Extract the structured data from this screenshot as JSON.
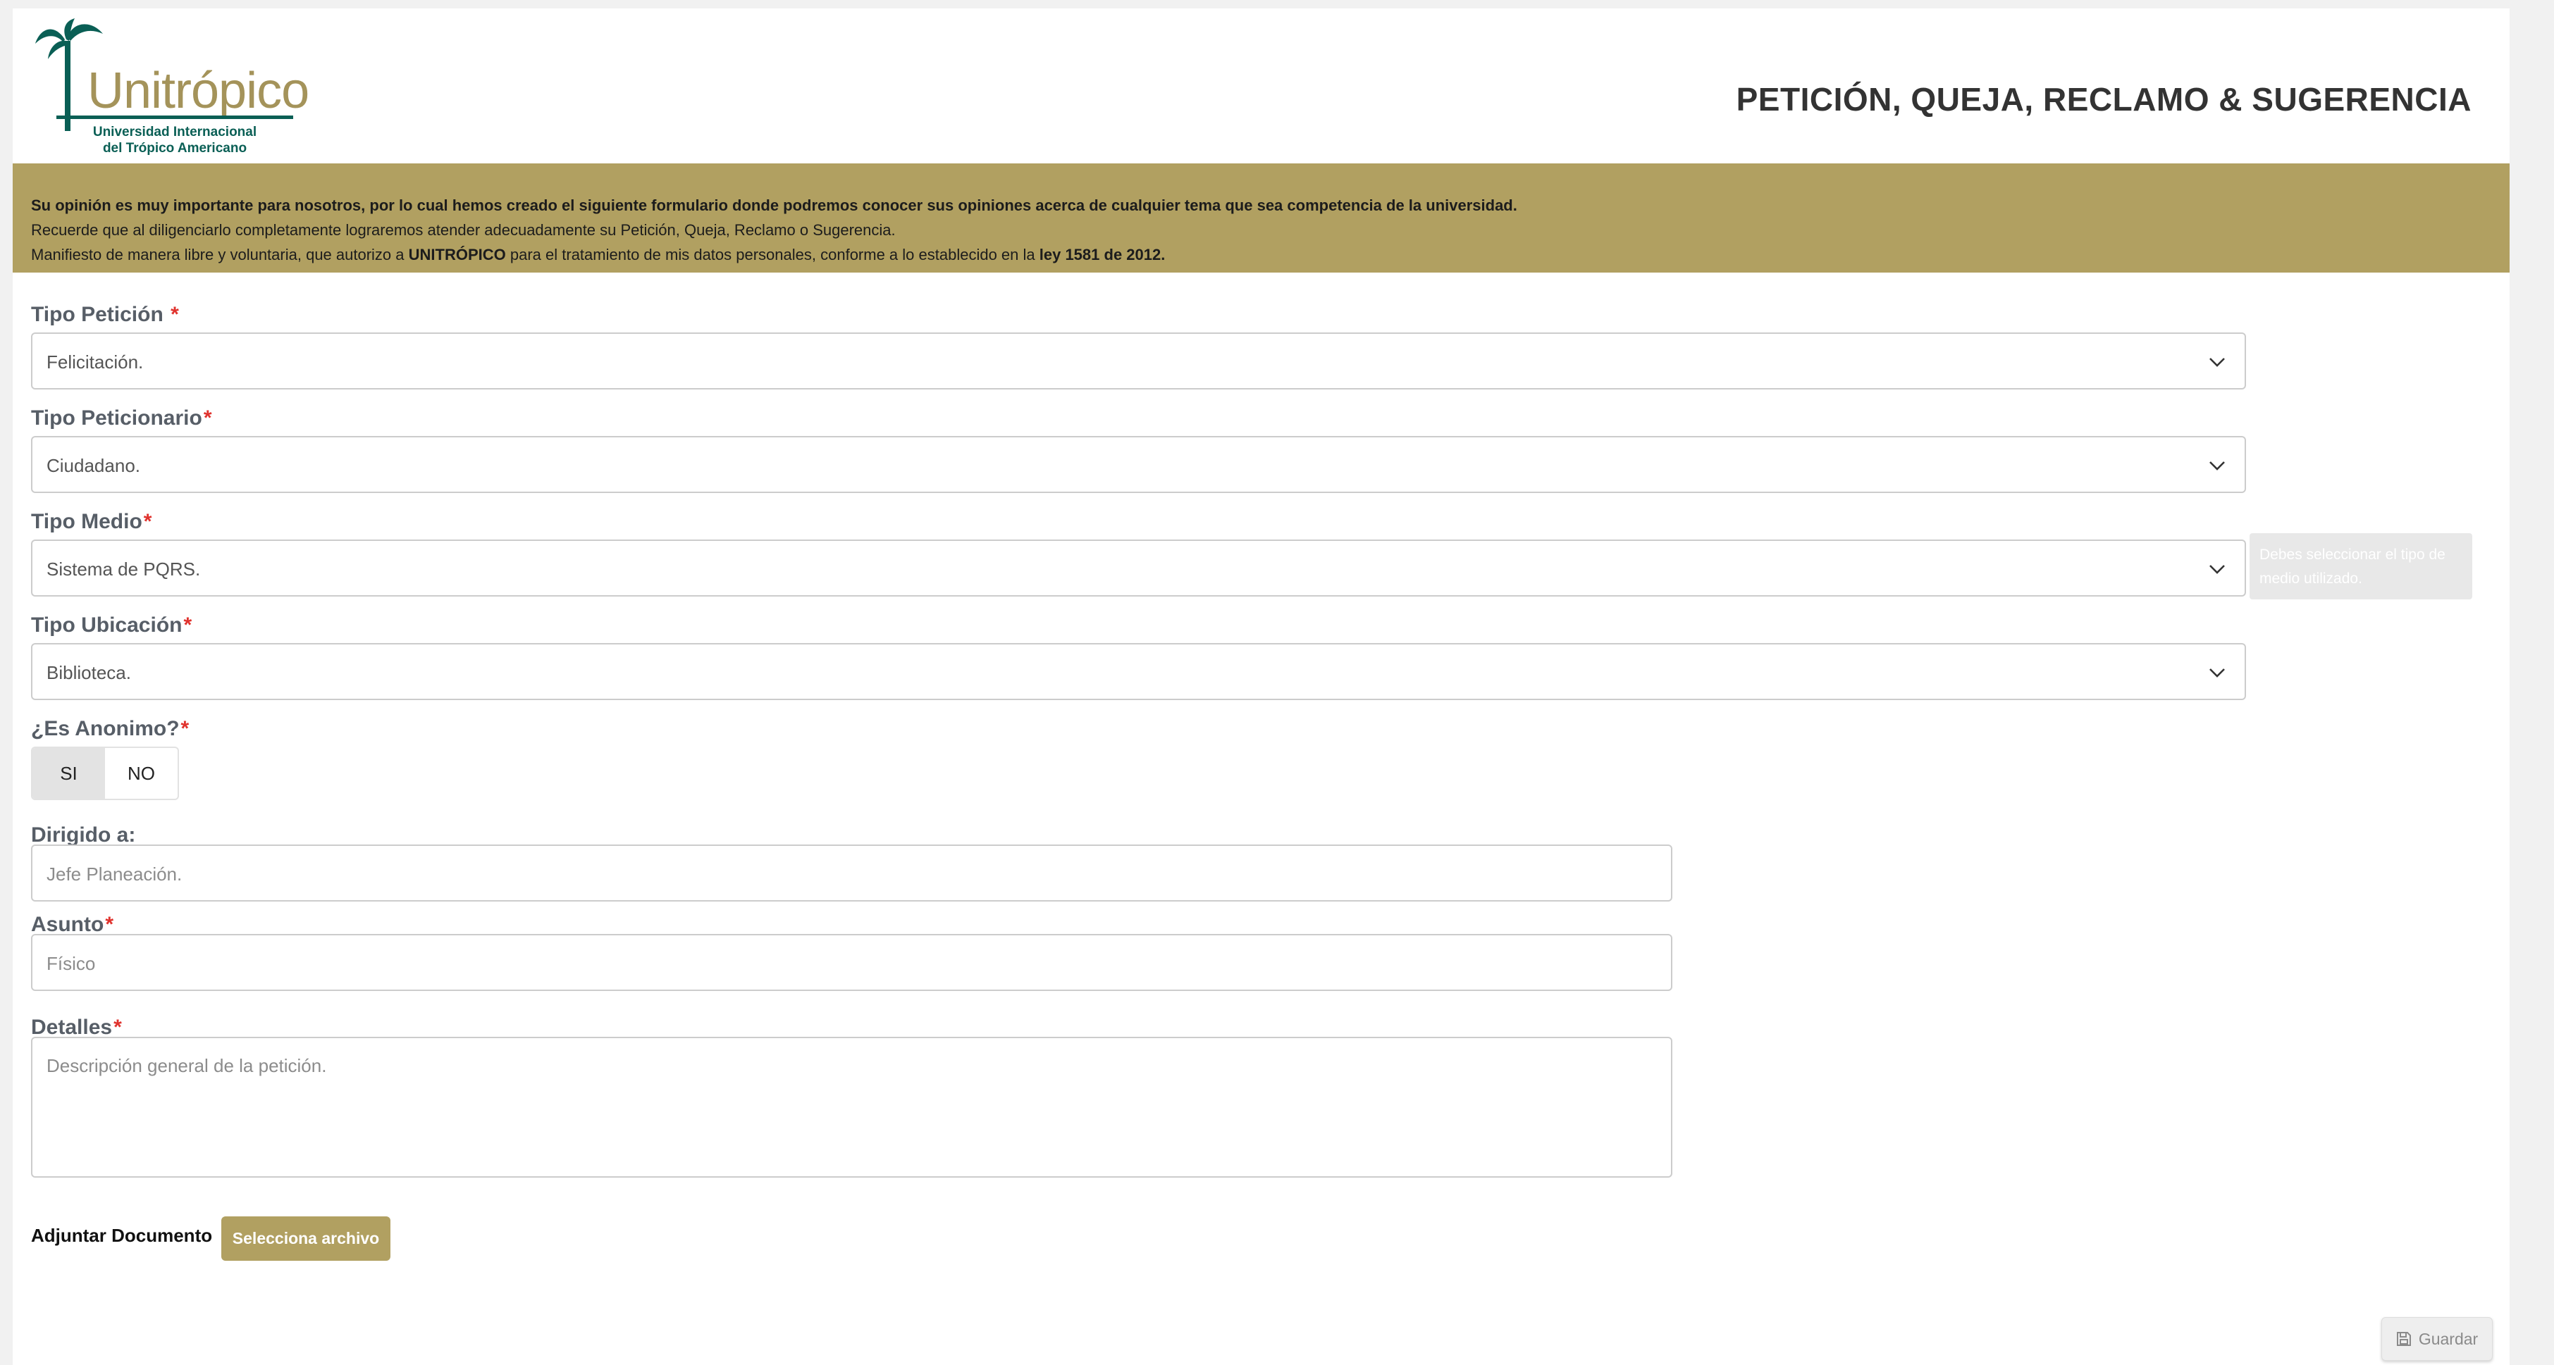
{
  "logo": {
    "word": "Unitrópico",
    "sub_line1": "Universidad Internacional",
    "sub_line2": "del Trópico Americano"
  },
  "header": {
    "title": "PETICIÓN, QUEJA, RECLAMO & SUGERENCIA"
  },
  "banner": {
    "line1": "Su opinión es muy importante para nosotros, por lo cual hemos creado el siguiente formulario donde podremos conocer sus opiniones acerca de cualquier tema que sea competencia de la universidad.",
    "line2": "Recuerde que al diligenciarlo completamente lograremos atender adecuadamente su Petición, Queja, Reclamo o Sugerencia.",
    "line3_a": "Manifiesto de manera libre y voluntaria, que autorizo a ",
    "line3_b": "UNITRÓPICO",
    "line3_c": " para el tratamiento de mis datos personales, conforme a lo establecido en la ",
    "line3_d": "ley 1581 de 2012."
  },
  "form": {
    "required_mark": "*",
    "tipo_peticion": {
      "label": "Tipo Petición",
      "value": "Felicitación."
    },
    "tipo_peticionario": {
      "label": "Tipo Peticionario",
      "value": "Ciudadano."
    },
    "tipo_medio": {
      "label": "Tipo Medio",
      "value": "Sistema de PQRS.",
      "tooltip_line1": "Debes seleccionar el tipo de",
      "tooltip_line2": "medio utilizado."
    },
    "tipo_ubicacion": {
      "label": "Tipo Ubicación",
      "value": "Biblioteca."
    },
    "anonimo": {
      "label": "¿Es Anonimo?",
      "yes": "SI",
      "no": "NO",
      "selected": "SI"
    },
    "dirigido": {
      "label": "Dirigido a:",
      "placeholder": "Jefe Planeación."
    },
    "asunto": {
      "label": "Asunto",
      "placeholder": "Físico"
    },
    "detalles": {
      "label": "Detalles",
      "placeholder": "Descripción general de la petición."
    },
    "adjuntar": {
      "label": "Adjuntar Documento",
      "button": "Selecciona archivo"
    },
    "guardar": {
      "label": "Guardar",
      "icon": "floppy-disk-icon"
    }
  },
  "colors": {
    "brand_gold": "#b1a061",
    "brand_green": "#0a5f55",
    "required_red": "#e0322d"
  }
}
